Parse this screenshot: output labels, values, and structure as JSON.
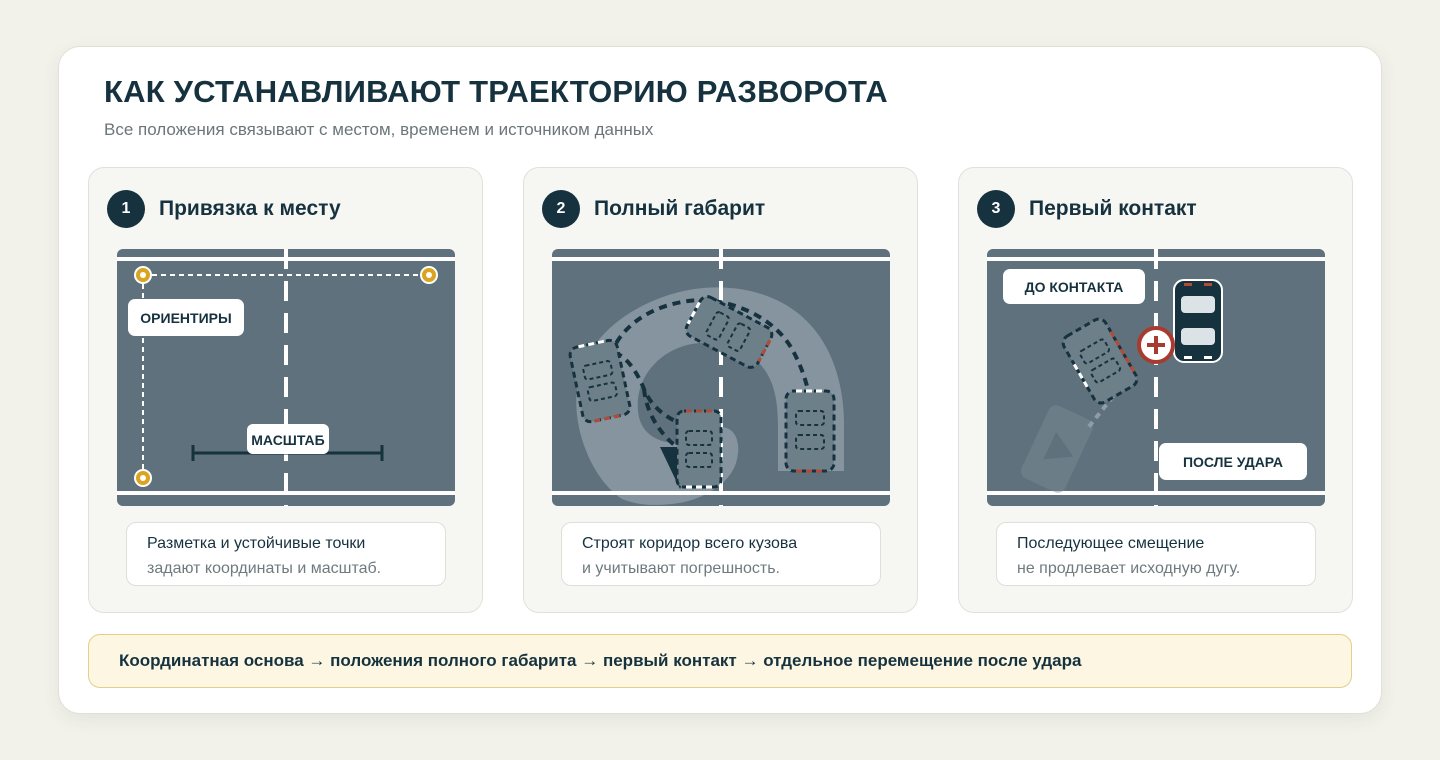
{
  "header": {
    "title": "КАК УСТАНАВЛИВАЮТ ТРАЕКТОРИЮ РАЗВОРОТА",
    "subtitle": "Все положения связывают с местом, временем и источником данных"
  },
  "panels": [
    {
      "number": "1",
      "title": "Привязка к месту",
      "labels": {
        "landmarks": "ОРИЕНТИРЫ",
        "scale": "МАСШТАБ"
      },
      "caption_line1": "Разметка и устойчивые точки",
      "caption_line2": "задают координаты и масштаб."
    },
    {
      "number": "2",
      "title": "Полный габарит",
      "caption_line1": "Строят коридор всего кузова",
      "caption_line2": "и учитывают погрешность."
    },
    {
      "number": "3",
      "title": "Первый контакт",
      "labels": {
        "before": "ДО КОНТАКТА",
        "after": "ПОСЛЕ УДАРА"
      },
      "caption_line1": "Последующее смещение",
      "caption_line2": "не продлевает исходную дугу."
    }
  ],
  "footer": {
    "text": "Координатная основа → положения полного габарита → первый контакт → отдельное перемещение после удара"
  },
  "colors": {
    "road": "#5f717c",
    "navy": "#16323f",
    "accent_gold": "#d9a521",
    "brake_red": "#b24c3a",
    "contact_red": "#a83a30",
    "footer_bg": "#fcf6e2"
  },
  "icons": [
    "landmark-pin-icon",
    "scale-bar-icon",
    "car-outline-icon",
    "direction-arrow-icon",
    "contact-cross-icon",
    "parked-car-icon"
  ]
}
